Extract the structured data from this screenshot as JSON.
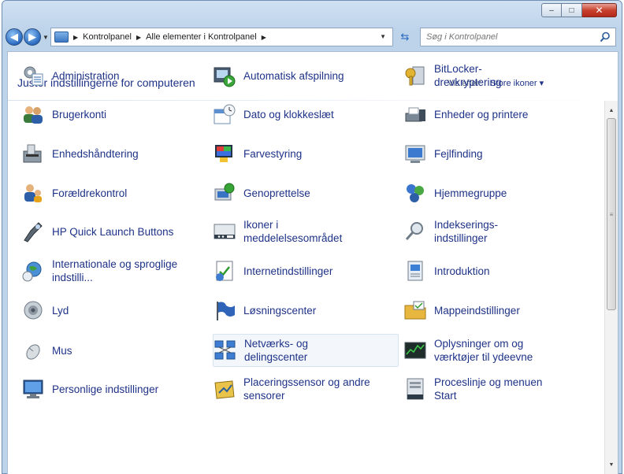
{
  "window": {
    "caption": {
      "minimize": "–",
      "maximize": "□",
      "close": "✕"
    }
  },
  "nav": {
    "back_icon": "back-arrow-icon",
    "forward_icon": "forward-arrow-icon",
    "breadcrumbs": [
      "Kontrolpanel",
      "Alle elementer i Kontrolpanel"
    ],
    "search_placeholder": "Søg i Kontrolpanel"
  },
  "header": {
    "title": "Juster indstillingerne for computeren",
    "view_by_label": "Vis efter:",
    "view_by_value": "Store ikoner ▾"
  },
  "items": [
    {
      "label": "Administration",
      "icon": "administration-icon"
    },
    {
      "label": "Automatisk afspilning",
      "icon": "autoplay-icon"
    },
    {
      "label": "BitLocker-\ndrevkryptering",
      "icon": "bitlocker-icon"
    },
    {
      "label": "Brugerkonti",
      "icon": "user-accounts-icon"
    },
    {
      "label": "Dato og klokkeslæt",
      "icon": "date-time-icon"
    },
    {
      "label": "Enheder og printere",
      "icon": "devices-printers-icon"
    },
    {
      "label": "Enhedshåndtering",
      "icon": "device-manager-icon"
    },
    {
      "label": "Farvestyring",
      "icon": "color-management-icon"
    },
    {
      "label": "Fejlfinding",
      "icon": "troubleshooting-icon"
    },
    {
      "label": "Forældrekontrol",
      "icon": "parental-controls-icon"
    },
    {
      "label": "Genoprettelse",
      "icon": "recovery-icon"
    },
    {
      "label": "Hjemmegruppe",
      "icon": "homegroup-icon"
    },
    {
      "label": "HP Quick Launch Buttons",
      "icon": "hp-quick-launch-icon"
    },
    {
      "label": "Ikoner i\nmeddelelsesområdet",
      "icon": "notification-icons-icon"
    },
    {
      "label": "Indekserings-\nindstillinger",
      "icon": "indexing-options-icon"
    },
    {
      "label": "Internationale og sproglige\nindstilli...",
      "icon": "region-language-icon"
    },
    {
      "label": "Internetindstillinger",
      "icon": "internet-options-icon"
    },
    {
      "label": "Introduktion",
      "icon": "getting-started-icon"
    },
    {
      "label": "Lyd",
      "icon": "sound-icon"
    },
    {
      "label": "Løsningscenter",
      "icon": "action-center-icon"
    },
    {
      "label": "Mappeindstillinger",
      "icon": "folder-options-icon"
    },
    {
      "label": "Mus",
      "icon": "mouse-icon"
    },
    {
      "label": "Netværks- og\ndelingscenter",
      "icon": "network-sharing-icon"
    },
    {
      "label": "Oplysninger om og\nværktøjer til ydeevne",
      "icon": "performance-tools-icon"
    },
    {
      "label": "Personlige indstillinger",
      "icon": "personalization-icon"
    },
    {
      "label": "Placeringssensor og andre\nsensorer",
      "icon": "location-sensors-icon"
    },
    {
      "label": "Proceslinje og menuen\nStart",
      "icon": "taskbar-start-icon"
    }
  ],
  "selected_item": "Netværks- og\ndelingscenter"
}
